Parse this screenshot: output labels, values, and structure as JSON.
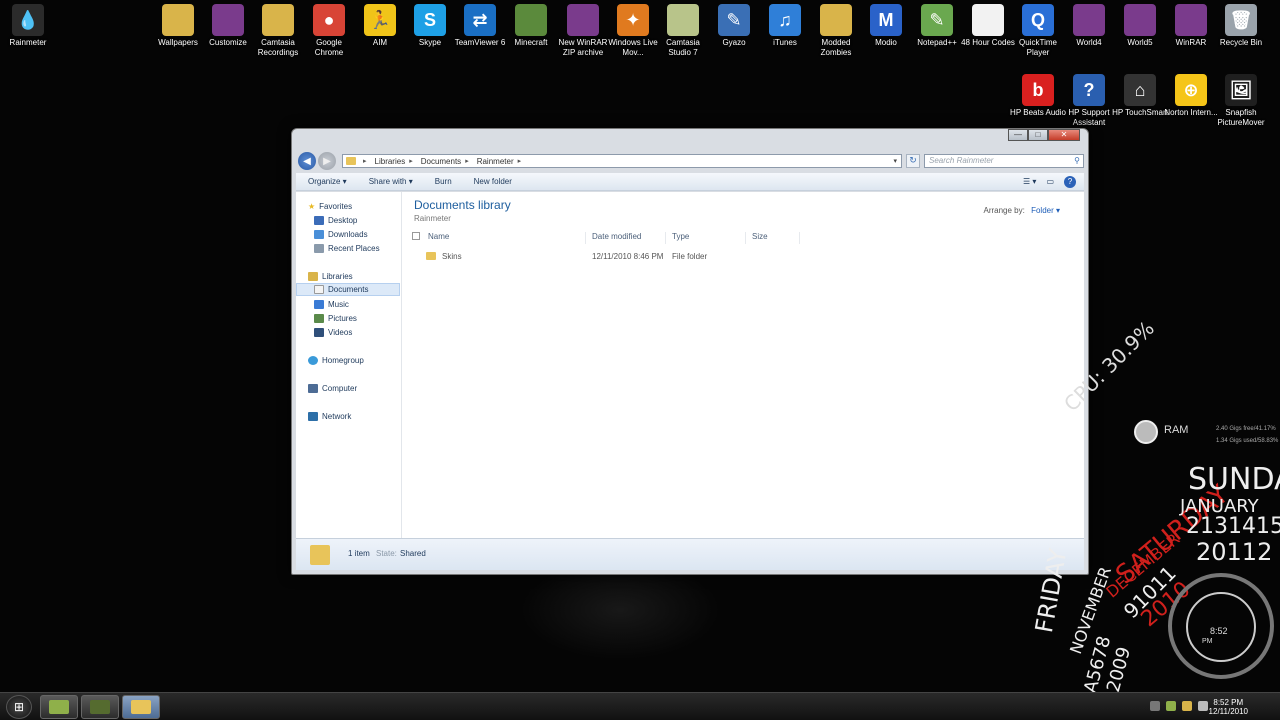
{
  "desktop": {
    "icons_top": [
      {
        "label": "Rainmeter",
        "icon": "rainmeter-icon",
        "color": "#2b2b2b",
        "glyph": "💧"
      },
      {
        "label": "Wallpapers",
        "icon": "folder-icon",
        "color": "#d9b44a",
        "glyph": ""
      },
      {
        "label": "Customize",
        "icon": "winrar-icon",
        "color": "#7a3b8c",
        "glyph": ""
      },
      {
        "label": "Camtasia Recordings",
        "icon": "folder-icon",
        "color": "#d9b44a",
        "glyph": ""
      },
      {
        "label": "Google Chrome",
        "icon": "chrome-icon",
        "color": "#d84436",
        "glyph": "●"
      },
      {
        "label": "AIM",
        "icon": "aim-icon",
        "color": "#f0c419",
        "glyph": "🏃"
      },
      {
        "label": "Skype",
        "icon": "skype-icon",
        "color": "#1ea0e6",
        "glyph": "S"
      },
      {
        "label": "TeamViewer 6",
        "icon": "teamviewer-icon",
        "color": "#1a6fc4",
        "glyph": "⇄"
      },
      {
        "label": "Minecraft",
        "icon": "minecraft-icon",
        "color": "#5b8a3c",
        "glyph": ""
      },
      {
        "label": "New WinRAR ZIP archive",
        "icon": "winrar-icon",
        "color": "#7a3b8c",
        "glyph": ""
      },
      {
        "label": "Windows Live Mov...",
        "icon": "movie-maker-icon",
        "color": "#e07a1f",
        "glyph": "✦"
      },
      {
        "label": "Camtasia Studio 7",
        "icon": "camtasia-icon",
        "color": "#b8c48a",
        "glyph": ""
      },
      {
        "label": "Gyazo",
        "icon": "gyazo-icon",
        "color": "#3a6fb5",
        "glyph": "✎"
      },
      {
        "label": "iTunes",
        "icon": "itunes-icon",
        "color": "#2f7fd8",
        "glyph": "♫"
      },
      {
        "label": "Modded Zombies",
        "icon": "folder-icon",
        "color": "#d9b44a",
        "glyph": ""
      },
      {
        "label": "Modio",
        "icon": "modio-icon",
        "color": "#2a62c9",
        "glyph": "M"
      },
      {
        "label": "Notepad++",
        "icon": "notepadpp-icon",
        "color": "#6aa84f",
        "glyph": "✎"
      },
      {
        "label": "48 Hour Codes",
        "icon": "document-icon",
        "color": "#f2f2f2",
        "glyph": ""
      },
      {
        "label": "QuickTime Player",
        "icon": "quicktime-icon",
        "color": "#2a6fd6",
        "glyph": "Q"
      },
      {
        "label": "World4",
        "icon": "winrar-icon",
        "color": "#7a3b8c",
        "glyph": ""
      },
      {
        "label": "World5",
        "icon": "winrar-icon",
        "color": "#7a3b8c",
        "glyph": ""
      },
      {
        "label": "WinRAR",
        "icon": "winrar-icon",
        "color": "#7a3b8c",
        "glyph": ""
      },
      {
        "label": "Recycle Bin",
        "icon": "recycle-bin-icon",
        "color": "#9aa3ab",
        "glyph": "🗑"
      }
    ],
    "icons_second": [
      {
        "label": "HP Beats Audio",
        "icon": "beats-icon",
        "color": "#d9201f",
        "glyph": "b"
      },
      {
        "label": "HP Support Assistant",
        "icon": "hp-support-icon",
        "color": "#2a5fb0",
        "glyph": "?"
      },
      {
        "label": "HP TouchSmart",
        "icon": "touchsmart-icon",
        "color": "#333333",
        "glyph": "⌂"
      },
      {
        "label": "Norton Intern...",
        "icon": "norton-icon",
        "color": "#f5c518",
        "glyph": "⊕"
      },
      {
        "label": "Snapfish PictureMover",
        "icon": "snapfish-icon",
        "color": "#1f1f1f",
        "glyph": "🖼"
      }
    ]
  },
  "window": {
    "controls": {
      "minimize": "—",
      "maximize": "□",
      "close": "✕"
    },
    "nav": {
      "back": "◀",
      "forward": "▶"
    },
    "breadcrumbs": [
      "Libraries",
      "Documents",
      "Rainmeter"
    ],
    "breadcrumb_sep": "▸",
    "address_dropdown": "▾",
    "refresh": "↻",
    "search_placeholder": "Search Rainmeter",
    "search_icon_glyph": "⚲",
    "toolbar": {
      "organize": "Organize ▾",
      "share_with": "Share with ▾",
      "burn": "Burn",
      "new_folder": "New folder",
      "views": "☰ ▾",
      "preview": "▭",
      "help": "?"
    },
    "nav_pane": {
      "favorites": "Favorites",
      "favorites_items": [
        "Desktop",
        "Downloads",
        "Recent Places"
      ],
      "libraries": "Libraries",
      "libraries_items": [
        "Documents",
        "Music",
        "Pictures",
        "Videos"
      ],
      "homegroup": "Homegroup",
      "computer": "Computer",
      "network": "Network"
    },
    "library": {
      "title": "Documents library",
      "subtitle": "Rainmeter",
      "arrange_by_label": "Arrange by:",
      "arrange_by_value": "Folder ▾"
    },
    "columns": [
      "Name",
      "Date modified",
      "Type",
      "Size"
    ],
    "rows": [
      {
        "name": "Skins",
        "date_modified": "12/11/2010 8:46 PM",
        "type": "File folder",
        "size": ""
      }
    ],
    "status": {
      "count": "1 item",
      "state": "State:",
      "shared": "Shared"
    }
  },
  "widgets": {
    "cpu": "CPU: 30.9%",
    "ram_label": "RAM",
    "ram_stats": [
      "2.40 Gigs free/41.17%",
      "1.34 Gigs used/58.83%"
    ],
    "calendar": {
      "days": [
        "SATURDAY",
        "SUNDAY",
        "FRIDAY"
      ],
      "months": [
        "DECEMBER",
        "JANUARY",
        "NOVEMBER"
      ],
      "numbers": [
        "2131415",
        "91011",
        "A5678",
        "12009",
        "20112",
        "2010"
      ],
      "accent_color": "#d0201c"
    },
    "clock": {
      "time": "8:52",
      "ampm": "PM"
    }
  },
  "taskbar": {
    "start": "⊞",
    "apps": [
      {
        "name": "minecraft-task",
        "color": "#8fb04a",
        "active": false
      },
      {
        "name": "camtasia-task",
        "color": "#556b2f",
        "active": false
      },
      {
        "name": "explorer-task",
        "color": "#e8c45a",
        "active": true
      }
    ],
    "tray_time": "8:52 PM",
    "tray_date": "12/11/2010"
  }
}
